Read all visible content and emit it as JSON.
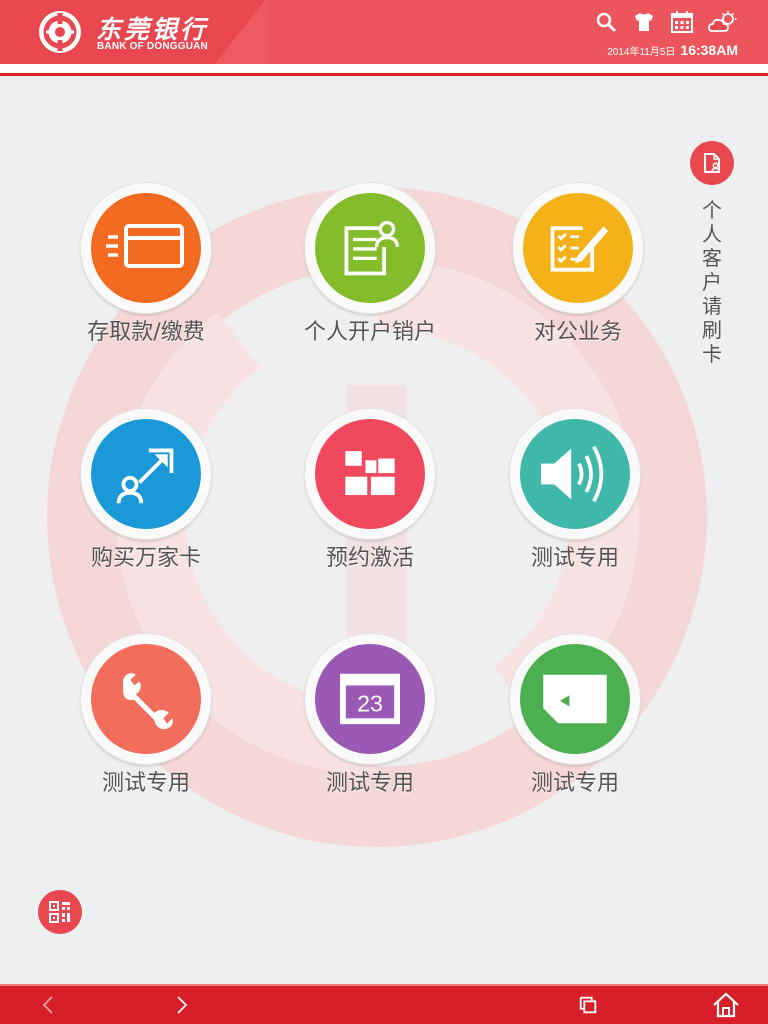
{
  "brand": {
    "name_cn": "东莞银行",
    "name_en": "BANK OF DONGGUAN",
    "color": "#e8474f"
  },
  "status": {
    "date": "2014年11月5日",
    "time": "16:38AM",
    "icons": [
      "search-icon",
      "shirt-icon",
      "calendar-icon",
      "weather-icon"
    ]
  },
  "tiles": [
    {
      "label": "存取款/缴费",
      "icon": "card-icon",
      "color": "#f26b21"
    },
    {
      "label": "个人开户销户",
      "icon": "account-form-icon",
      "color": "#84bd2b"
    },
    {
      "label": "对公业务",
      "icon": "checklist-edit-icon",
      "color": "#f5b218"
    },
    {
      "label": "购买万家卡",
      "icon": "person-arrow-icon",
      "color": "#1b98d8"
    },
    {
      "label": "预约激活",
      "icon": "blocks-icon",
      "color": "#f0485c"
    },
    {
      "label": "测试专用",
      "icon": "speaker-icon",
      "color": "#3fb8a9"
    },
    {
      "label": "测试专用",
      "icon": "wrench-icon",
      "color": "#f26d5b"
    },
    {
      "label": "测试专用",
      "icon": "calendar-23-icon",
      "color": "#9b59b6"
    },
    {
      "label": "测试专用",
      "icon": "sim-card-icon",
      "color": "#4caf50"
    }
  ],
  "calendar_tile_day": "23",
  "side_prompt": {
    "text": "个人客户请刷卡",
    "icon": "id-card-icon"
  },
  "qr_button": {
    "icon": "qr-code-icon"
  },
  "navbar": {
    "back_icon": "chevron-left-icon",
    "forward_icon": "chevron-right-icon",
    "recent_icon": "recent-apps-icon",
    "home_icon": "home-icon",
    "color": "#d61f28"
  }
}
